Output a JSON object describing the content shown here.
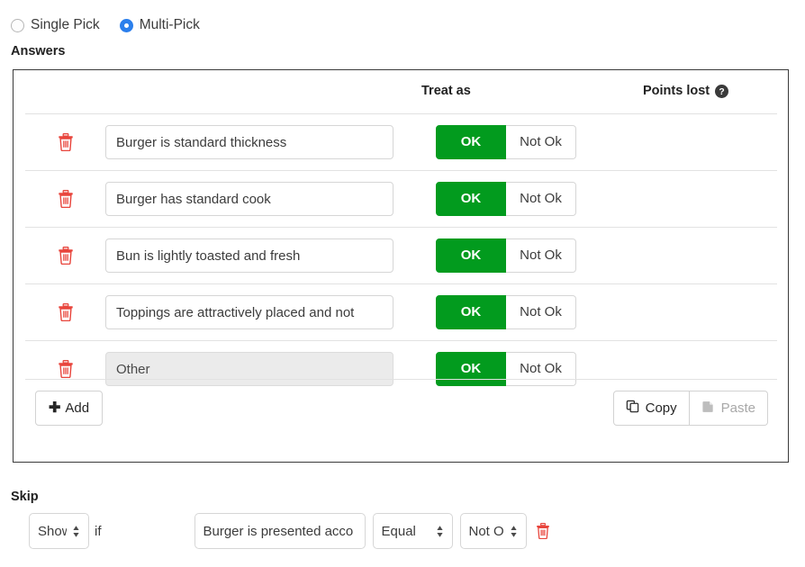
{
  "pick_type": {
    "options": [
      {
        "label": "Single Pick",
        "selected": false
      },
      {
        "label": "Multi-Pick",
        "selected": true
      }
    ],
    "accent_color": "#2b7fec"
  },
  "answers": {
    "title": "Answers",
    "columns": {
      "treat_as": "Treat as",
      "points_lost": "Points lost",
      "points_lost_help_icon": "help-circle-icon"
    },
    "ok_color": "#029b1e",
    "delete_icon": "trash-icon",
    "rows": [
      {
        "text": "Burger is standard thickness",
        "ok_label": "OK",
        "not_ok_label": "Not Ok",
        "treat_as": "OK",
        "disabled": false
      },
      {
        "text": "Burger has standard cook",
        "ok_label": "OK",
        "not_ok_label": "Not Ok",
        "treat_as": "OK",
        "disabled": false
      },
      {
        "text": "Bun is lightly toasted and fresh",
        "ok_label": "OK",
        "not_ok_label": "Not Ok",
        "treat_as": "OK",
        "disabled": false
      },
      {
        "text": "Toppings are attractively placed and not",
        "ok_label": "OK",
        "not_ok_label": "Not Ok",
        "treat_as": "OK",
        "disabled": false
      },
      {
        "text": "Other",
        "ok_label": "OK",
        "not_ok_label": "Not Ok",
        "treat_as": "OK",
        "disabled": true
      }
    ],
    "footer": {
      "add_label": "Add",
      "add_icon": "plus-icon",
      "copy_label": "Copy",
      "copy_icon": "copy-icon",
      "paste_label": "Paste",
      "paste_icon": "paste-icon",
      "paste_disabled": true
    }
  },
  "skip": {
    "title": "Skip",
    "action": "Show",
    "if_label": "if",
    "question": "Burger is presented acco",
    "operator": "Equal",
    "value": "Not Ok",
    "delete_icon": "trash-icon"
  }
}
